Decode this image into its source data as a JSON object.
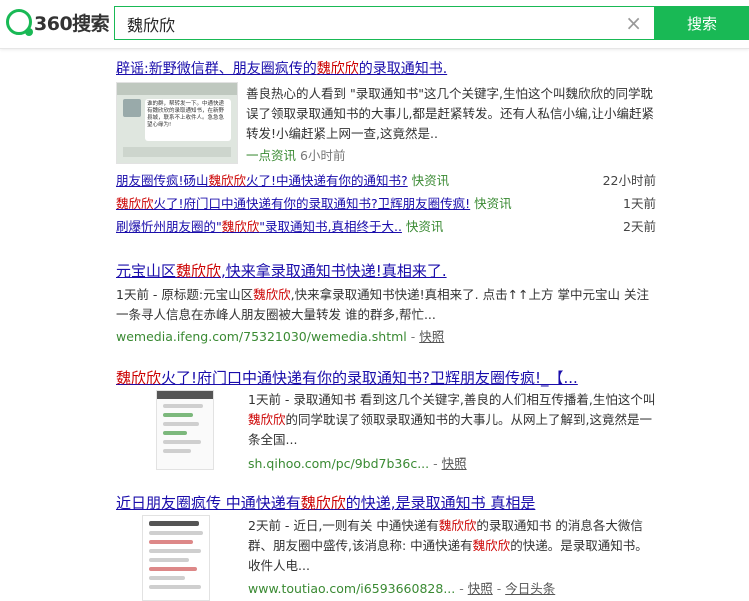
{
  "header": {
    "logo_text": "360搜索",
    "query": "魏欣欣",
    "search_button": "搜索",
    "clear_glyph": "×"
  },
  "news_block": {
    "title_pre": "辟谣:新野微信群、朋友圈疯传的",
    "title_hl": "魏欣欣",
    "title_post": "的录取通知书.",
    "thumb_text": "谁的群，帮转发一下。中通快递有魏欣欣的录取通知书，在新野县城，联系不上收件人。急急急望心缘为!",
    "snippet": "善良热心的人看到 \"录取通知书\"这几个关键字,生怕这个叫魏欣欣的同学耽误了领取录取通知书的大事儿,都是赶紧转发。还有人私信小编,让小编赶紧转发!小编赶紧上网一查,这竟然是..",
    "source": "一点资讯",
    "time": "6小时前",
    "rows": [
      {
        "pre": "朋友圈传疯!砀山",
        "hl": "魏欣欣",
        "post": "火了!中通快递有你的通知书?",
        "src": "快资讯",
        "time": "22小时前"
      },
      {
        "pre": "",
        "hl": "魏欣欣",
        "post": "火了!府门口中通快递有你的录取通知书?卫辉朋友圈传疯!",
        "src": "快资讯",
        "time": "1天前"
      },
      {
        "pre": "刷爆忻州朋友圈的\"",
        "hl": "魏欣欣",
        "post": "\"录取通知书,真相终于大..",
        "src": "快资讯",
        "time": "2天前"
      }
    ]
  },
  "results": [
    {
      "title_pre": "元宝山区",
      "title_hl": "魏欣欣",
      "title_post": ",快来拿录取通知书快递!真相来了.",
      "snippet_pre": "1天前 - 原标题:元宝山区",
      "snippet_hl": "魏欣欣",
      "snippet_post": ",快来拿录取通知书快递!真相来了. 点击↑↑上方 掌中元宝山 关注一条寻人信息在赤峰人朋友圈被大量转发 谁的群多,帮忙...",
      "url": "wemedia.ifeng.com/75321030/wemedia.shtml",
      "cache": "快照"
    },
    {
      "title_pre": "",
      "title_hl": "魏欣欣",
      "title_post": "火了!府门口中通快递有你的录取通知书?卫辉朋友圈传疯!_【...",
      "snippet_pre": "1天前 - 录取通知书 看到这几个关键字,善良的人们相互传播着,生怕这个叫",
      "snippet_hl": "魏欣欣",
      "snippet_post": "的同学耽误了领取录取通知书的大事儿。从网上了解到,这竟然是一条全国...",
      "url": "sh.qihoo.com/pc/9bd7b36c...",
      "cache": "快照"
    },
    {
      "title_pre": "近日朋友圈疯传 中通快递有",
      "title_hl": "魏欣欣",
      "title_post": "的快递,是录取通知书 真相是",
      "snippet_pre": "2天前 - 近日,一则有关 中通快递有",
      "snippet_hl": "魏欣欣",
      "snippet_mid": "的录取通知书 的消息各大微信群、朋友圈中盛传,该消息称: 中通快递有",
      "snippet_hl2": "魏欣欣",
      "snippet_post": "的快递。是录取通知书。收件人电...",
      "url": "www.toutiao.com/i6593660828...",
      "cache": "快照",
      "source": "今日头条"
    }
  ],
  "colors": {
    "brand_green": "#19b955",
    "link": "#1a0dab",
    "highlight": "#c00000",
    "url_green": "#3a8a33"
  }
}
